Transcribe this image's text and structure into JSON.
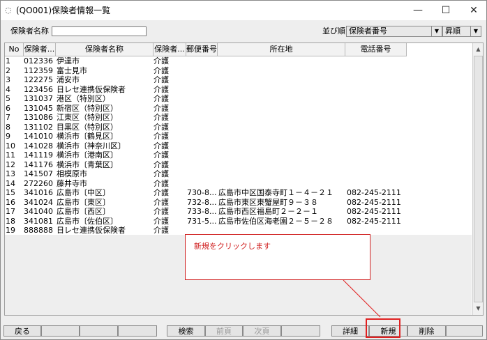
{
  "window": {
    "title": "(QO001)保険者情報一覧",
    "minimize_glyph": "—",
    "maximize_glyph": "☐",
    "close_glyph": "✕",
    "app_icon": "window-app-icon"
  },
  "filter": {
    "insurer_name_label": "保険者名称",
    "insurer_name_value": "",
    "sort_label": "並び順",
    "sort_value": "保険者番号",
    "order_value": "昇順"
  },
  "table": {
    "headers": [
      "No",
      "保険者...",
      "保険者名称",
      "保険者...",
      "郵便番号",
      "所在地",
      "電話番号"
    ],
    "rows": [
      [
        "1",
        "012336",
        "伊達市",
        "介護",
        "",
        "",
        ""
      ],
      [
        "2",
        "112359",
        "富士見市",
        "介護",
        "",
        "",
        ""
      ],
      [
        "3",
        "122275",
        "浦安市",
        "介護",
        "",
        "",
        ""
      ],
      [
        "4",
        "123456",
        "日レセ連携仮保険者",
        "介護",
        "",
        "",
        ""
      ],
      [
        "5",
        "131037",
        "港区（特別区）",
        "介護",
        "",
        "",
        ""
      ],
      [
        "6",
        "131045",
        "新宿区（特別区）",
        "介護",
        "",
        "",
        ""
      ],
      [
        "7",
        "131086",
        "江東区（特別区）",
        "介護",
        "",
        "",
        ""
      ],
      [
        "8",
        "131102",
        "目黒区（特別区）",
        "介護",
        "",
        "",
        ""
      ],
      [
        "9",
        "141010",
        "横浜市〔鶴見区〕",
        "介護",
        "",
        "",
        ""
      ],
      [
        "10",
        "141028",
        "横浜市〔神奈川区〕",
        "介護",
        "",
        "",
        ""
      ],
      [
        "11",
        "141119",
        "横浜市〔港南区〕",
        "介護",
        "",
        "",
        ""
      ],
      [
        "12",
        "141176",
        "横浜市〔青葉区〕",
        "介護",
        "",
        "",
        ""
      ],
      [
        "13",
        "141507",
        "相模原市",
        "介護",
        "",
        "",
        ""
      ],
      [
        "14",
        "272260",
        "藤井寺市",
        "介護",
        "",
        "",
        ""
      ],
      [
        "15",
        "341016",
        "広島市〔中区〕",
        "介護",
        "730-8...",
        "広島市中区国泰寺町１－４－２１",
        "082-245-2111"
      ],
      [
        "16",
        "341024",
        "広島市〔東区〕",
        "介護",
        "732-8...",
        "広島市東区東蟹屋町９－３８",
        "082-245-2111"
      ],
      [
        "17",
        "341040",
        "広島市〔西区〕",
        "介護",
        "733-8...",
        "広島市西区福島町２－２－１",
        "082-245-2111"
      ],
      [
        "18",
        "341081",
        "広島市〔佐伯区〕",
        "介護",
        "731-5...",
        "広島市佐伯区海老園２－５－２８",
        "082-245-2111"
      ],
      [
        "19",
        "888888",
        "日レセ連携仮保険者",
        "介護",
        "",
        "",
        ""
      ]
    ]
  },
  "annotation": {
    "text": "新規をクリックします"
  },
  "fkeys": {
    "back": "戻る",
    "search": "検索",
    "prev_page": "前頁",
    "next_page": "次頁",
    "detail": "詳細",
    "new": "新規",
    "delete": "削除"
  },
  "colors": {
    "accent_red": "#d02020",
    "disabled_text": "#9a9a9a"
  }
}
